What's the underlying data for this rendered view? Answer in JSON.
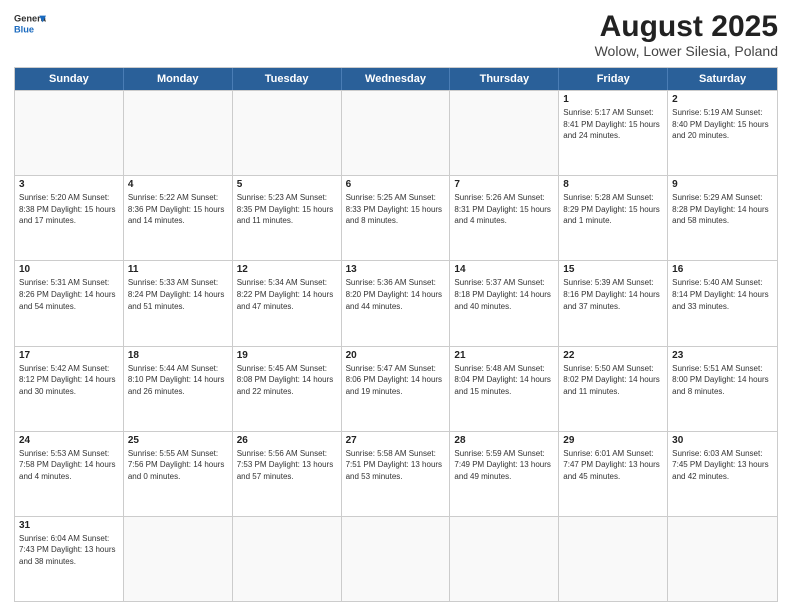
{
  "header": {
    "logo_general": "General",
    "logo_blue": "Blue",
    "title": "August 2025",
    "subtitle": "Wolow, Lower Silesia, Poland"
  },
  "days_of_week": [
    "Sunday",
    "Monday",
    "Tuesday",
    "Wednesday",
    "Thursday",
    "Friday",
    "Saturday"
  ],
  "weeks": [
    [
      {
        "day": "",
        "info": ""
      },
      {
        "day": "",
        "info": ""
      },
      {
        "day": "",
        "info": ""
      },
      {
        "day": "",
        "info": ""
      },
      {
        "day": "",
        "info": ""
      },
      {
        "day": "1",
        "info": "Sunrise: 5:17 AM\nSunset: 8:41 PM\nDaylight: 15 hours\nand 24 minutes."
      },
      {
        "day": "2",
        "info": "Sunrise: 5:19 AM\nSunset: 8:40 PM\nDaylight: 15 hours\nand 20 minutes."
      }
    ],
    [
      {
        "day": "3",
        "info": "Sunrise: 5:20 AM\nSunset: 8:38 PM\nDaylight: 15 hours\nand 17 minutes."
      },
      {
        "day": "4",
        "info": "Sunrise: 5:22 AM\nSunset: 8:36 PM\nDaylight: 15 hours\nand 14 minutes."
      },
      {
        "day": "5",
        "info": "Sunrise: 5:23 AM\nSunset: 8:35 PM\nDaylight: 15 hours\nand 11 minutes."
      },
      {
        "day": "6",
        "info": "Sunrise: 5:25 AM\nSunset: 8:33 PM\nDaylight: 15 hours\nand 8 minutes."
      },
      {
        "day": "7",
        "info": "Sunrise: 5:26 AM\nSunset: 8:31 PM\nDaylight: 15 hours\nand 4 minutes."
      },
      {
        "day": "8",
        "info": "Sunrise: 5:28 AM\nSunset: 8:29 PM\nDaylight: 15 hours\nand 1 minute."
      },
      {
        "day": "9",
        "info": "Sunrise: 5:29 AM\nSunset: 8:28 PM\nDaylight: 14 hours\nand 58 minutes."
      }
    ],
    [
      {
        "day": "10",
        "info": "Sunrise: 5:31 AM\nSunset: 8:26 PM\nDaylight: 14 hours\nand 54 minutes."
      },
      {
        "day": "11",
        "info": "Sunrise: 5:33 AM\nSunset: 8:24 PM\nDaylight: 14 hours\nand 51 minutes."
      },
      {
        "day": "12",
        "info": "Sunrise: 5:34 AM\nSunset: 8:22 PM\nDaylight: 14 hours\nand 47 minutes."
      },
      {
        "day": "13",
        "info": "Sunrise: 5:36 AM\nSunset: 8:20 PM\nDaylight: 14 hours\nand 44 minutes."
      },
      {
        "day": "14",
        "info": "Sunrise: 5:37 AM\nSunset: 8:18 PM\nDaylight: 14 hours\nand 40 minutes."
      },
      {
        "day": "15",
        "info": "Sunrise: 5:39 AM\nSunset: 8:16 PM\nDaylight: 14 hours\nand 37 minutes."
      },
      {
        "day": "16",
        "info": "Sunrise: 5:40 AM\nSunset: 8:14 PM\nDaylight: 14 hours\nand 33 minutes."
      }
    ],
    [
      {
        "day": "17",
        "info": "Sunrise: 5:42 AM\nSunset: 8:12 PM\nDaylight: 14 hours\nand 30 minutes."
      },
      {
        "day": "18",
        "info": "Sunrise: 5:44 AM\nSunset: 8:10 PM\nDaylight: 14 hours\nand 26 minutes."
      },
      {
        "day": "19",
        "info": "Sunrise: 5:45 AM\nSunset: 8:08 PM\nDaylight: 14 hours\nand 22 minutes."
      },
      {
        "day": "20",
        "info": "Sunrise: 5:47 AM\nSunset: 8:06 PM\nDaylight: 14 hours\nand 19 minutes."
      },
      {
        "day": "21",
        "info": "Sunrise: 5:48 AM\nSunset: 8:04 PM\nDaylight: 14 hours\nand 15 minutes."
      },
      {
        "day": "22",
        "info": "Sunrise: 5:50 AM\nSunset: 8:02 PM\nDaylight: 14 hours\nand 11 minutes."
      },
      {
        "day": "23",
        "info": "Sunrise: 5:51 AM\nSunset: 8:00 PM\nDaylight: 14 hours\nand 8 minutes."
      }
    ],
    [
      {
        "day": "24",
        "info": "Sunrise: 5:53 AM\nSunset: 7:58 PM\nDaylight: 14 hours\nand 4 minutes."
      },
      {
        "day": "25",
        "info": "Sunrise: 5:55 AM\nSunset: 7:56 PM\nDaylight: 14 hours\nand 0 minutes."
      },
      {
        "day": "26",
        "info": "Sunrise: 5:56 AM\nSunset: 7:53 PM\nDaylight: 13 hours\nand 57 minutes."
      },
      {
        "day": "27",
        "info": "Sunrise: 5:58 AM\nSunset: 7:51 PM\nDaylight: 13 hours\nand 53 minutes."
      },
      {
        "day": "28",
        "info": "Sunrise: 5:59 AM\nSunset: 7:49 PM\nDaylight: 13 hours\nand 49 minutes."
      },
      {
        "day": "29",
        "info": "Sunrise: 6:01 AM\nSunset: 7:47 PM\nDaylight: 13 hours\nand 45 minutes."
      },
      {
        "day": "30",
        "info": "Sunrise: 6:03 AM\nSunset: 7:45 PM\nDaylight: 13 hours\nand 42 minutes."
      }
    ],
    [
      {
        "day": "31",
        "info": "Sunrise: 6:04 AM\nSunset: 7:43 PM\nDaylight: 13 hours\nand 38 minutes."
      },
      {
        "day": "",
        "info": ""
      },
      {
        "day": "",
        "info": ""
      },
      {
        "day": "",
        "info": ""
      },
      {
        "day": "",
        "info": ""
      },
      {
        "day": "",
        "info": ""
      },
      {
        "day": "",
        "info": ""
      }
    ]
  ]
}
